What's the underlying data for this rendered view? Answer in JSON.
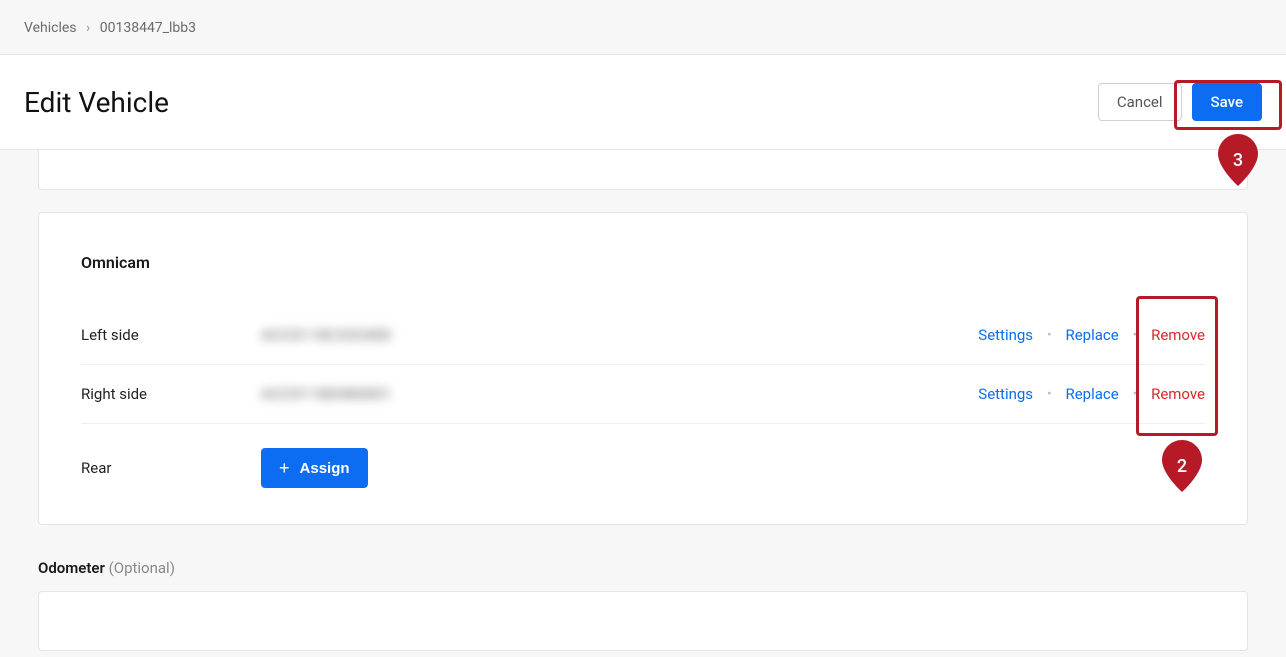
{
  "breadcrumb": {
    "root": "Vehicles",
    "separator": "›",
    "current": "00138447_lbb3"
  },
  "header": {
    "title": "Edit Vehicle",
    "cancel": "Cancel",
    "save": "Save"
  },
  "omnicam": {
    "title": "Omnicam",
    "rows": [
      {
        "label": "Left side",
        "id": "ACC0118C332400",
        "settings": "Settings",
        "replace": "Replace",
        "remove": "Remove"
      },
      {
        "label": "Right side",
        "id": "ACC0118D080001",
        "settings": "Settings",
        "replace": "Replace",
        "remove": "Remove"
      }
    ],
    "rear": {
      "label": "Rear",
      "assign": "Assign"
    }
  },
  "odometer": {
    "label": "Odometer",
    "optional": "(Optional)"
  },
  "annotations": {
    "pin2": "2",
    "pin3": "3"
  }
}
